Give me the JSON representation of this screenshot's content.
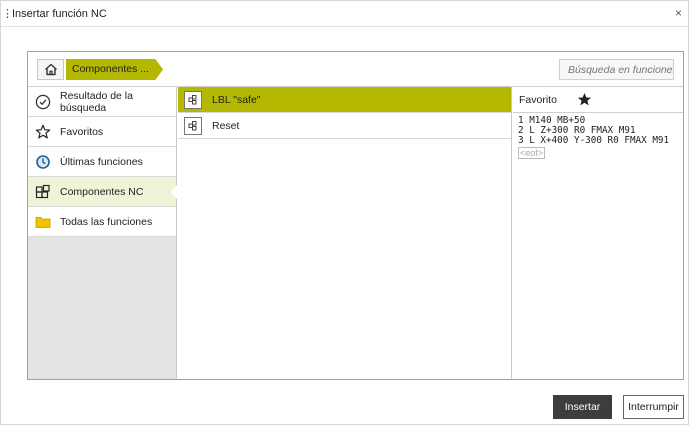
{
  "dialog": {
    "title": "Insertar función NC",
    "close_glyph": "×",
    "drag_glyph": "⋮"
  },
  "breadcrumb": {
    "home_icon": "home-icon",
    "current": "Componentes ..."
  },
  "search": {
    "placeholder": "Búsqueda en funciones NC"
  },
  "sidebar": {
    "items": [
      {
        "label": "Resultado de la búsqueda",
        "icon": "check-circle-icon"
      },
      {
        "label": "Favoritos",
        "icon": "star-outline-icon"
      },
      {
        "label": "Últimas funciones",
        "icon": "clock-icon"
      },
      {
        "label": "Componentes NC",
        "icon": "components-icon",
        "active": true
      },
      {
        "label": "Todas las funciones",
        "icon": "folder-icon"
      }
    ]
  },
  "list": {
    "items": [
      {
        "label": "LBL \"safe\"",
        "icon": "nc-doc-icon",
        "selected": true
      },
      {
        "label": "Reset",
        "icon": "nc-doc-icon",
        "selected": false
      }
    ]
  },
  "preview": {
    "header": "Favorito",
    "star_icon": "star-filled-icon",
    "lines": [
      "1 M140 MB+50",
      "2 L Z+300 R0 FMAX M91",
      "3 L X+400 Y-300 R0 FMAX M91"
    ],
    "eof": "<eof>"
  },
  "buttons": {
    "insert": "Insertar",
    "cancel": "Interrumpir"
  },
  "colors": {
    "accent": "#b5b800",
    "accent_light": "#f1f3d8",
    "primary_button": "#3d3d3d",
    "sidebar_bg": "#e3e3e3",
    "clock_blue": "#1e5e96",
    "folder_yellow": "#f2c200"
  }
}
